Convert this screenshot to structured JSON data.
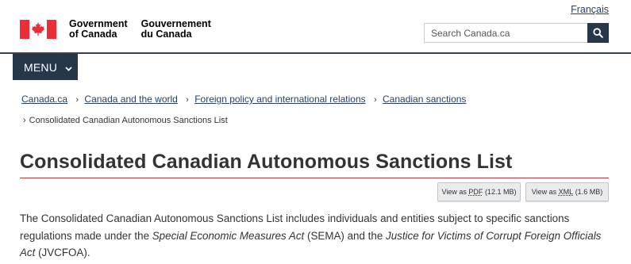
{
  "header": {
    "language_link": "Français",
    "signature_en_line1": "Government",
    "signature_en_line2": "of Canada",
    "signature_fr_line1": "Gouvernement",
    "signature_fr_line2": "du Canada",
    "search_placeholder": "Search Canada.ca",
    "menu_label": "MENU",
    "colors": {
      "flag_red": "#eb2d37",
      "nav_dark": "#26374a"
    }
  },
  "breadcrumbs": {
    "items": [
      "Canada.ca",
      "Canada and the world",
      "Foreign policy and international relations",
      "Canadian sanctions"
    ],
    "current": "Consolidated Canadian Autonomous Sanctions List"
  },
  "page": {
    "title": "Consolidated Canadian Autonomous Sanctions List",
    "downloads": {
      "pdf_prefix": "View as",
      "pdf_format": "PDF",
      "pdf_size": "(12.1 MB)",
      "xml_prefix": "View as",
      "xml_format": "XML",
      "xml_size": "(1.6 MB)"
    },
    "intro": {
      "part1": "The Consolidated Canadian Autonomous Sanctions List includes individuals and entities subject to specific sanctions regulations made under the ",
      "act1": "Special Economic Measures Act",
      "part2": " (SEMA) and the ",
      "act2": "Justice for Victims of Corrupt Foreign Officials Act",
      "part3": " (JVCFOA)."
    }
  }
}
